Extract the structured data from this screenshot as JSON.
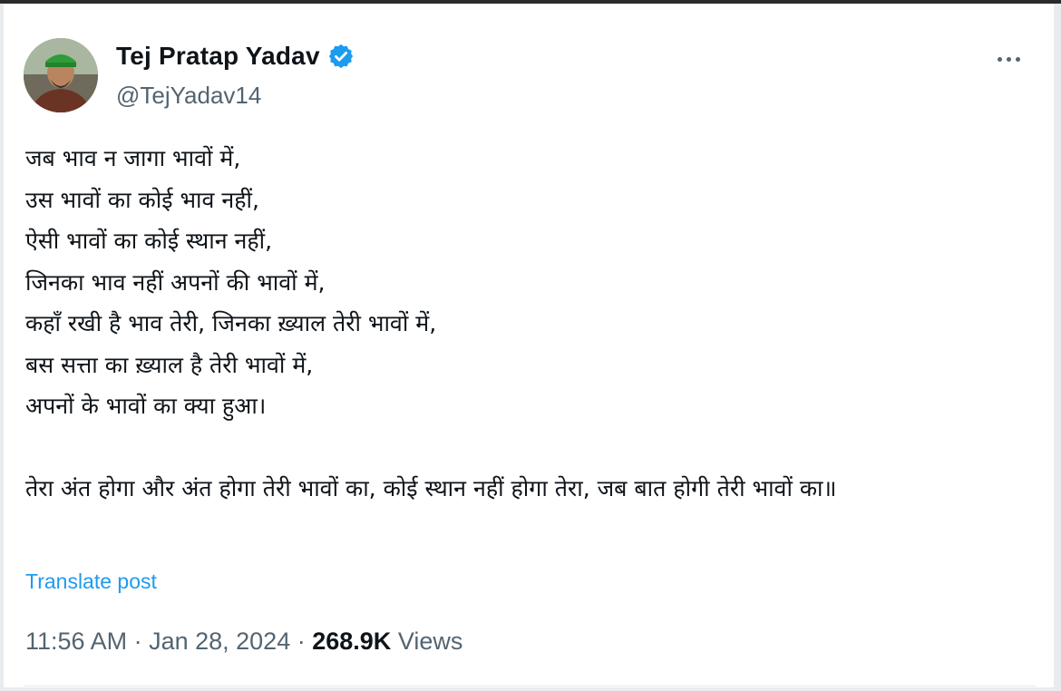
{
  "author": {
    "display_name": "Tej Pratap Yadav",
    "handle": "@TejYadav14",
    "verified": true,
    "avatar_icon": "profile-photo"
  },
  "post": {
    "lines": [
      "जब भाव न जागा भावों में,",
      "उस भावों का कोई भाव नहीं,",
      "ऐसी भावों का कोई स्थान नहीं,",
      "जिनका भाव नहीं अपनों की भावों में,",
      "कहाँ रखी है भाव तेरी, जिनका ख़्याल तेरी भावों में,",
      "बस सत्ता का ख़्याल है तेरी भावों में,",
      "अपनों के भावों का क्या हुआ।"
    ],
    "final_paragraph": "तेरा अंत होगा और अंत होगा तेरी भावों का, कोई स्थान नहीं होगा तेरा, जब बात होगी तेरी भावों का॥"
  },
  "actions": {
    "translate_label": "Translate post",
    "more_icon": "more-horizontal-icon"
  },
  "meta": {
    "time": "11:56 AM",
    "separator": " · ",
    "date": "Jan 28, 2024",
    "views_count": "268.9K",
    "views_label": "Views"
  },
  "colors": {
    "link": "#1d9bf0",
    "secondary_text": "#536471",
    "verified_badge": "#1d9bf0"
  }
}
